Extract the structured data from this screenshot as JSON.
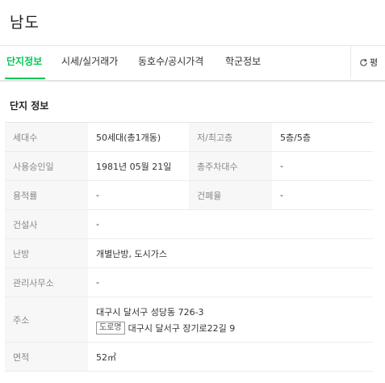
{
  "header": {
    "title": "남도"
  },
  "tabs": [
    {
      "label": "단지정보",
      "active": true
    },
    {
      "label": "시세/실거래가",
      "active": false
    },
    {
      "label": "동호수/공시가격",
      "active": false
    },
    {
      "label": "학군정보",
      "active": false
    }
  ],
  "tab_more": {
    "label": "평",
    "icon": "refresh-icon"
  },
  "section": {
    "title": "단지 정보"
  },
  "info": {
    "households_label": "세대수",
    "households_value": "50세대(총1개동)",
    "floors_label": "저/최고층",
    "floors_value": "5층/5층",
    "approval_label": "사용승인일",
    "approval_value": "1981년 05월 21일",
    "parking_label": "총주차대수",
    "parking_value": "-",
    "far_label": "용적률",
    "far_value": "-",
    "bcr_label": "건폐율",
    "bcr_value": "-",
    "builder_label": "건설사",
    "builder_value": "-",
    "heating_label": "난방",
    "heating_value": "개별난방, 도시가스",
    "office_label": "관리사무소",
    "office_value": "-",
    "address_label": "주소",
    "address_lot": "대구시 달서구 성당동 726-3",
    "address_road_badge": "도로명",
    "address_road": "대구시 달서구 장기로22길 9",
    "area_label": "면적",
    "area_value": "52㎡"
  },
  "colors": {
    "accent": "#03c75a",
    "label_bg": "#f7f7f7",
    "border": "#ececec"
  }
}
